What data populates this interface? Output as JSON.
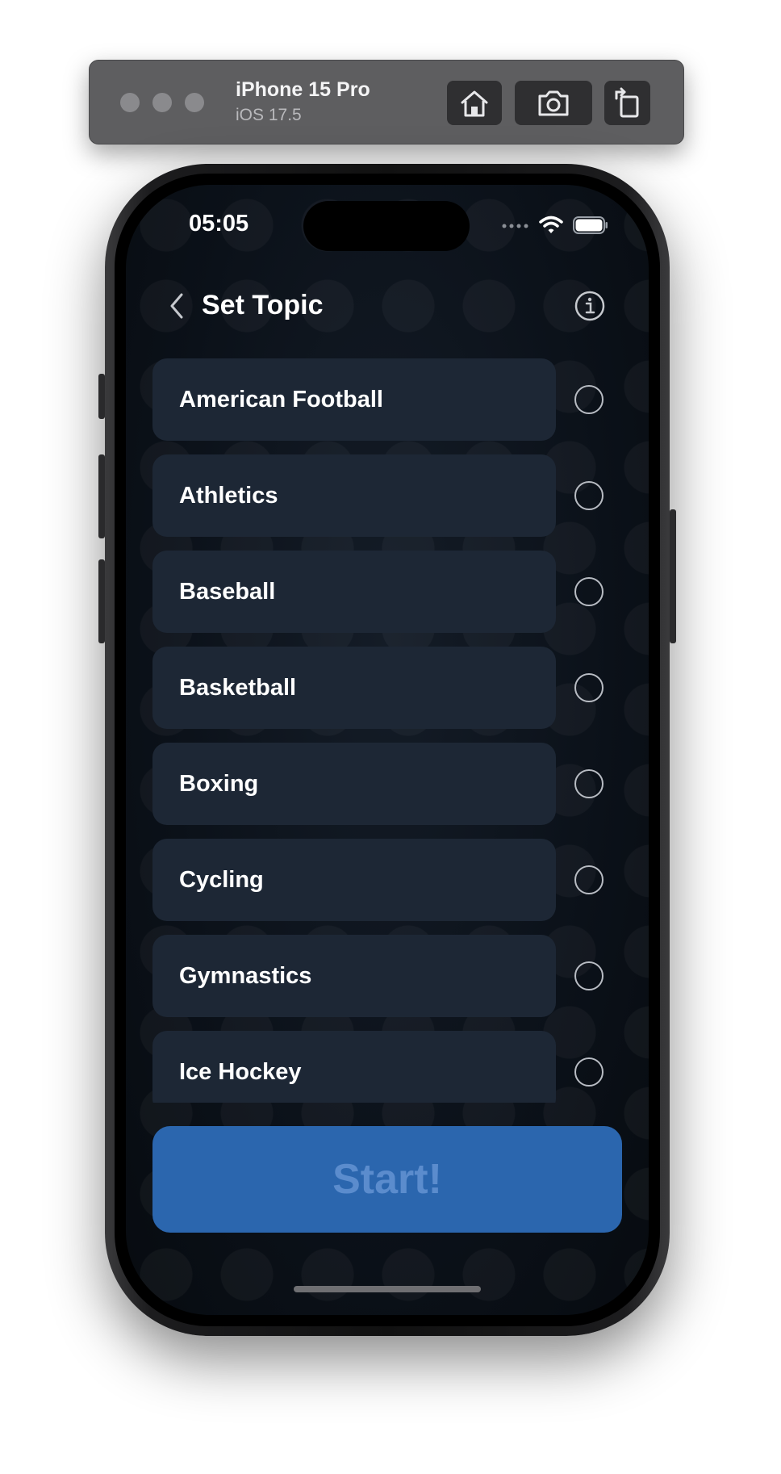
{
  "simulator": {
    "device_name": "iPhone 15 Pro",
    "os_version": "iOS 17.5",
    "toolbar_icons": [
      "home-icon",
      "camera-icon",
      "rotate-icon"
    ]
  },
  "status_bar": {
    "time": "05:05",
    "icons": [
      "signal-icon",
      "wifi-icon",
      "battery-icon"
    ]
  },
  "nav": {
    "title": "Set Topic",
    "back_icon": "chevron-left-icon",
    "info_icon": "info-icon"
  },
  "topics": [
    {
      "label": "American Football",
      "selected": false
    },
    {
      "label": "Athletics",
      "selected": false
    },
    {
      "label": "Baseball",
      "selected": false
    },
    {
      "label": "Basketball",
      "selected": false
    },
    {
      "label": "Boxing",
      "selected": false
    },
    {
      "label": "Cycling",
      "selected": false
    },
    {
      "label": "Gymnastics",
      "selected": false
    },
    {
      "label": "Ice Hockey",
      "selected": false
    }
  ],
  "start_button": {
    "label": "Start!"
  },
  "colors": {
    "accent": "#2b66ae",
    "card": "#1d2735",
    "background": "#0b1119"
  }
}
